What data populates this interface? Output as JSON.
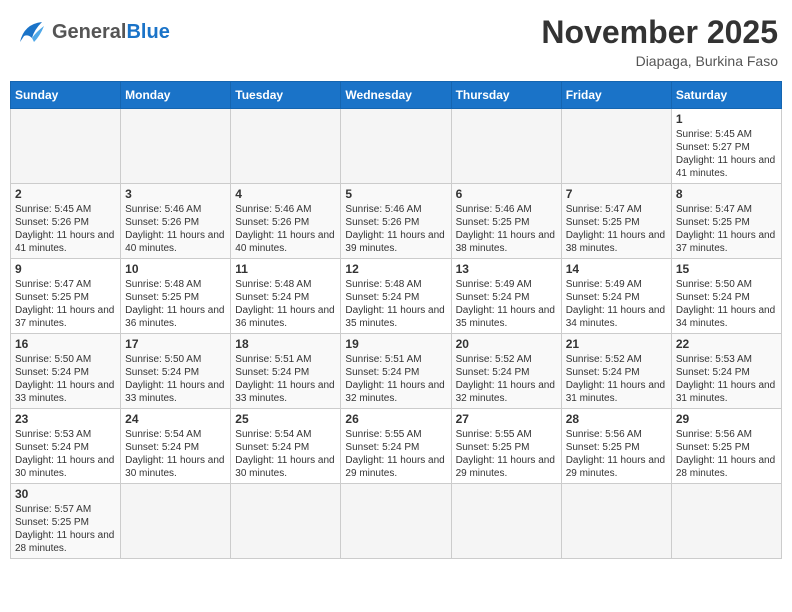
{
  "header": {
    "logo_general": "General",
    "logo_blue": "Blue",
    "month_title": "November 2025",
    "subtitle": "Diapaga, Burkina Faso"
  },
  "weekdays": [
    "Sunday",
    "Monday",
    "Tuesday",
    "Wednesday",
    "Thursday",
    "Friday",
    "Saturday"
  ],
  "weeks": [
    [
      {
        "day": "",
        "info": ""
      },
      {
        "day": "",
        "info": ""
      },
      {
        "day": "",
        "info": ""
      },
      {
        "day": "",
        "info": ""
      },
      {
        "day": "",
        "info": ""
      },
      {
        "day": "",
        "info": ""
      },
      {
        "day": "1",
        "info": "Sunrise: 5:45 AM\nSunset: 5:27 PM\nDaylight: 11 hours and 41 minutes."
      }
    ],
    [
      {
        "day": "2",
        "info": "Sunrise: 5:45 AM\nSunset: 5:26 PM\nDaylight: 11 hours and 41 minutes."
      },
      {
        "day": "3",
        "info": "Sunrise: 5:46 AM\nSunset: 5:26 PM\nDaylight: 11 hours and 40 minutes."
      },
      {
        "day": "4",
        "info": "Sunrise: 5:46 AM\nSunset: 5:26 PM\nDaylight: 11 hours and 40 minutes."
      },
      {
        "day": "5",
        "info": "Sunrise: 5:46 AM\nSunset: 5:26 PM\nDaylight: 11 hours and 39 minutes."
      },
      {
        "day": "6",
        "info": "Sunrise: 5:46 AM\nSunset: 5:25 PM\nDaylight: 11 hours and 38 minutes."
      },
      {
        "day": "7",
        "info": "Sunrise: 5:47 AM\nSunset: 5:25 PM\nDaylight: 11 hours and 38 minutes."
      },
      {
        "day": "8",
        "info": "Sunrise: 5:47 AM\nSunset: 5:25 PM\nDaylight: 11 hours and 37 minutes."
      }
    ],
    [
      {
        "day": "9",
        "info": "Sunrise: 5:47 AM\nSunset: 5:25 PM\nDaylight: 11 hours and 37 minutes."
      },
      {
        "day": "10",
        "info": "Sunrise: 5:48 AM\nSunset: 5:25 PM\nDaylight: 11 hours and 36 minutes."
      },
      {
        "day": "11",
        "info": "Sunrise: 5:48 AM\nSunset: 5:24 PM\nDaylight: 11 hours and 36 minutes."
      },
      {
        "day": "12",
        "info": "Sunrise: 5:48 AM\nSunset: 5:24 PM\nDaylight: 11 hours and 35 minutes."
      },
      {
        "day": "13",
        "info": "Sunrise: 5:49 AM\nSunset: 5:24 PM\nDaylight: 11 hours and 35 minutes."
      },
      {
        "day": "14",
        "info": "Sunrise: 5:49 AM\nSunset: 5:24 PM\nDaylight: 11 hours and 34 minutes."
      },
      {
        "day": "15",
        "info": "Sunrise: 5:50 AM\nSunset: 5:24 PM\nDaylight: 11 hours and 34 minutes."
      }
    ],
    [
      {
        "day": "16",
        "info": "Sunrise: 5:50 AM\nSunset: 5:24 PM\nDaylight: 11 hours and 33 minutes."
      },
      {
        "day": "17",
        "info": "Sunrise: 5:50 AM\nSunset: 5:24 PM\nDaylight: 11 hours and 33 minutes."
      },
      {
        "day": "18",
        "info": "Sunrise: 5:51 AM\nSunset: 5:24 PM\nDaylight: 11 hours and 33 minutes."
      },
      {
        "day": "19",
        "info": "Sunrise: 5:51 AM\nSunset: 5:24 PM\nDaylight: 11 hours and 32 minutes."
      },
      {
        "day": "20",
        "info": "Sunrise: 5:52 AM\nSunset: 5:24 PM\nDaylight: 11 hours and 32 minutes."
      },
      {
        "day": "21",
        "info": "Sunrise: 5:52 AM\nSunset: 5:24 PM\nDaylight: 11 hours and 31 minutes."
      },
      {
        "day": "22",
        "info": "Sunrise: 5:53 AM\nSunset: 5:24 PM\nDaylight: 11 hours and 31 minutes."
      }
    ],
    [
      {
        "day": "23",
        "info": "Sunrise: 5:53 AM\nSunset: 5:24 PM\nDaylight: 11 hours and 30 minutes."
      },
      {
        "day": "24",
        "info": "Sunrise: 5:54 AM\nSunset: 5:24 PM\nDaylight: 11 hours and 30 minutes."
      },
      {
        "day": "25",
        "info": "Sunrise: 5:54 AM\nSunset: 5:24 PM\nDaylight: 11 hours and 30 minutes."
      },
      {
        "day": "26",
        "info": "Sunrise: 5:55 AM\nSunset: 5:24 PM\nDaylight: 11 hours and 29 minutes."
      },
      {
        "day": "27",
        "info": "Sunrise: 5:55 AM\nSunset: 5:25 PM\nDaylight: 11 hours and 29 minutes."
      },
      {
        "day": "28",
        "info": "Sunrise: 5:56 AM\nSunset: 5:25 PM\nDaylight: 11 hours and 29 minutes."
      },
      {
        "day": "29",
        "info": "Sunrise: 5:56 AM\nSunset: 5:25 PM\nDaylight: 11 hours and 28 minutes."
      }
    ],
    [
      {
        "day": "30",
        "info": "Sunrise: 5:57 AM\nSunset: 5:25 PM\nDaylight: 11 hours and 28 minutes."
      },
      {
        "day": "",
        "info": ""
      },
      {
        "day": "",
        "info": ""
      },
      {
        "day": "",
        "info": ""
      },
      {
        "day": "",
        "info": ""
      },
      {
        "day": "",
        "info": ""
      },
      {
        "day": "",
        "info": ""
      }
    ]
  ]
}
